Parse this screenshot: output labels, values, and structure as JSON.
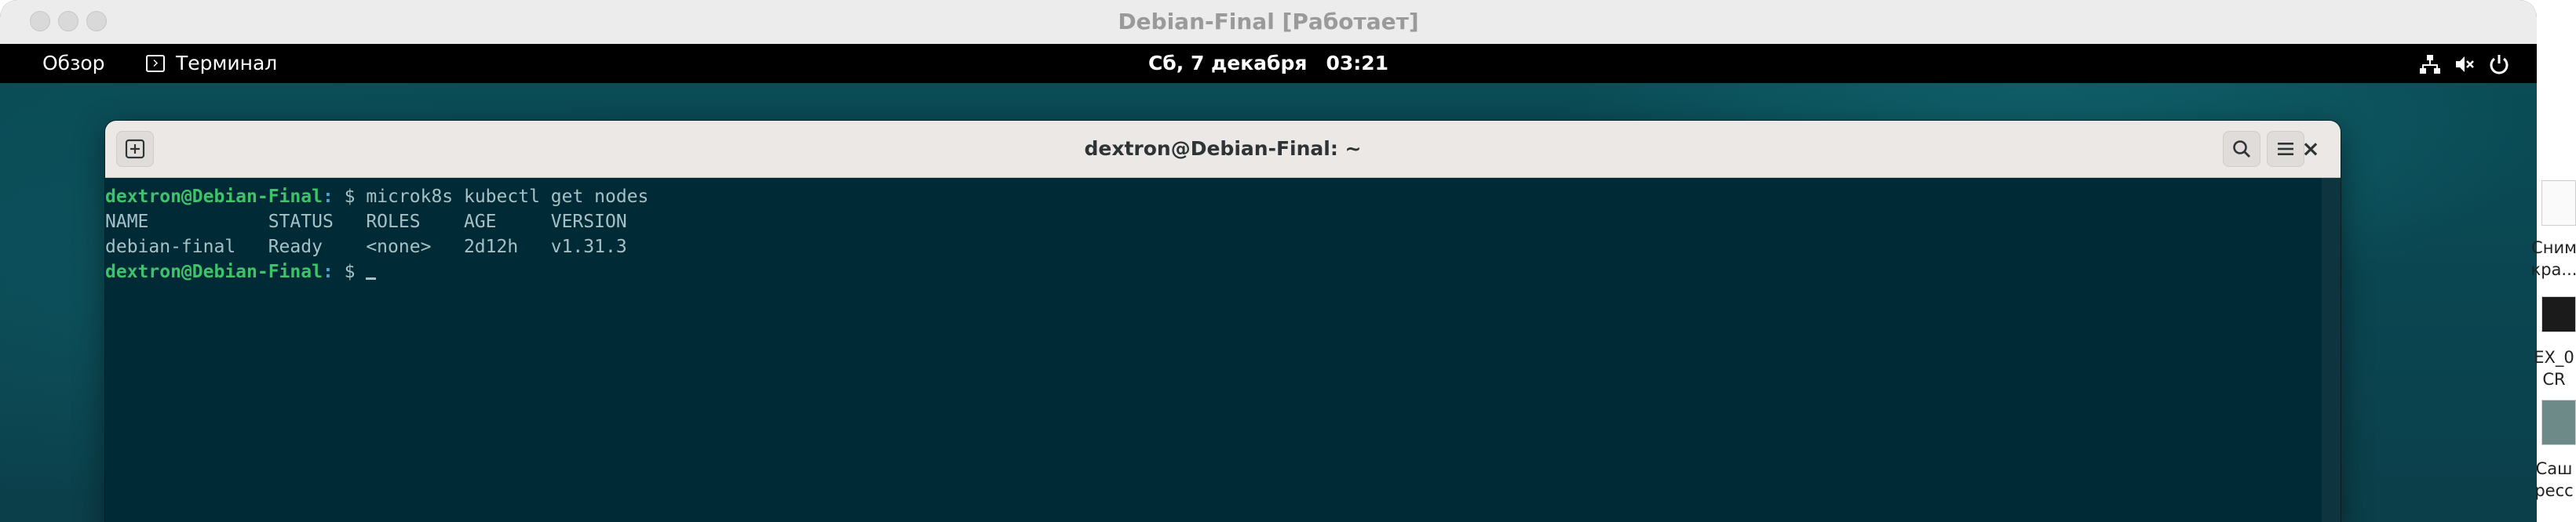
{
  "vm": {
    "title": "Debian-Final [Работает]"
  },
  "gnome_bar": {
    "overview_label": "Обзор",
    "app_label": "Терминал",
    "app_icon": "terminal-icon",
    "clock_date": "Сб, 7 декабря",
    "clock_time": "03:21",
    "tray_icons": [
      "network-icon",
      "volume-muted-icon",
      "power-icon"
    ]
  },
  "terminal": {
    "title": "dextron@Debian-Final: ~",
    "new_tab_icon": "new-tab-icon",
    "search_icon": "search-icon",
    "menu_icon": "hamburger-menu-icon",
    "close_icon": "close-icon",
    "lines": [
      {
        "user": "dextron@Debian-Final",
        "path": ":",
        "prompt": " $ ",
        "command": "microk8s kubectl get nodes"
      },
      {
        "output": "NAME           STATUS   ROLES    AGE     VERSION"
      },
      {
        "output": "debian-final   Ready    <none>   2d12h   v1.31.3"
      },
      {
        "user": "dextron@Debian-Final",
        "path": ":",
        "prompt": " $ ",
        "command": ""
      }
    ]
  },
  "host_desktop": {
    "items": [
      {
        "label_line1": "Сним",
        "label_line2": "кра..."
      },
      {
        "label_line1": "EX_0",
        "label_line2": "CR"
      },
      {
        "label_line1": "Саш",
        "label_line2": "ресс"
      }
    ]
  },
  "colors": {
    "terminal_bg": "#002b36",
    "prompt_user": "#3ec26a",
    "prompt_path": "#4ca3d4",
    "desktop_teal": "#0a4d57"
  }
}
